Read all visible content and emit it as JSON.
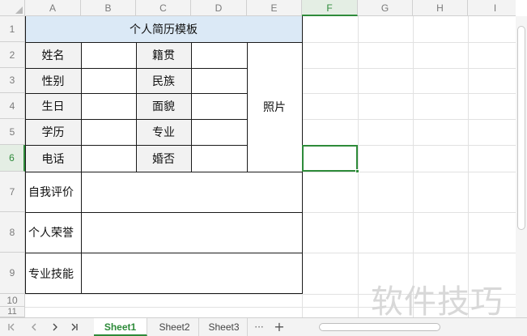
{
  "columns": [
    "A",
    "B",
    "C",
    "D",
    "E",
    "F",
    "G",
    "H",
    "I"
  ],
  "active_column": "F",
  "rows": [
    "1",
    "2",
    "3",
    "4",
    "5",
    "6",
    "7",
    "8",
    "9",
    "10",
    "11"
  ],
  "active_row": "6",
  "resume": {
    "title": "个人简历模板",
    "left_labels": [
      "姓名",
      "性别",
      "生日",
      "学历",
      "电话"
    ],
    "mid_labels": [
      "籍贯",
      "民族",
      "面貌",
      "专业",
      "婚否"
    ],
    "photo": "照片",
    "self_evaluation": "自我评价",
    "honors": "个人荣誉",
    "skills": "专业技能"
  },
  "tabs": {
    "items": [
      "Sheet1",
      "Sheet2",
      "Sheet3"
    ],
    "active": "Sheet1",
    "more": "···",
    "add": "+"
  },
  "watermark": "软件技巧",
  "colors": {
    "accent": "#2e8b3a",
    "title_fill": "#dbe9f6",
    "label_fill": "#f2f2f2"
  }
}
